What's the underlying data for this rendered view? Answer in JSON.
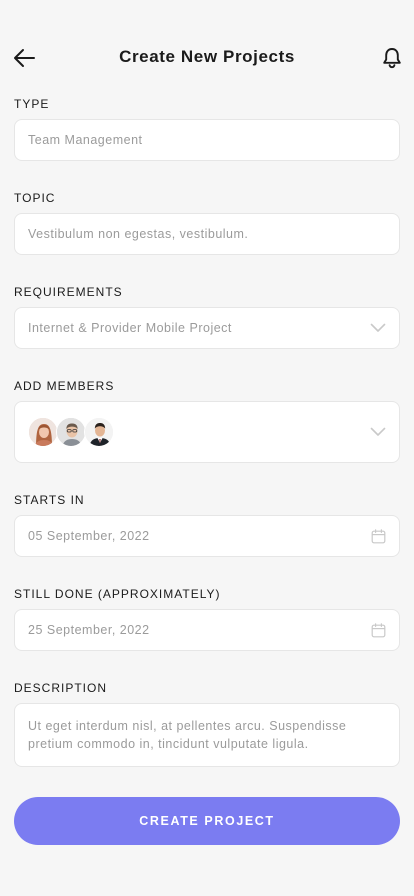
{
  "header": {
    "title": "Create New Projects",
    "back_icon": "arrow-left-icon",
    "notification_icon": "bell-icon"
  },
  "form": {
    "type": {
      "label": "TYPE",
      "value": "Team Management"
    },
    "topic": {
      "label": "TOPIC",
      "value": "Vestibulum non egestas, vestibulum."
    },
    "requirements": {
      "label": "REQUIREMENTS",
      "value": "Internet & Provider Mobile Project",
      "icon": "chevron-down-icon"
    },
    "members": {
      "label": "ADD MEMBERS",
      "avatars": [
        "avatar-woman",
        "avatar-man-glasses",
        "avatar-man-suit"
      ],
      "icon": "chevron-down-icon"
    },
    "starts_in": {
      "label": "STARTS IN",
      "value": "05 September, 2022",
      "icon": "calendar-icon"
    },
    "still_done": {
      "label": "STILL DONE (APPROXIMATELY)",
      "value": "25 September, 2022",
      "icon": "calendar-icon"
    },
    "description": {
      "label": "DESCRIPTION",
      "value": "Ut eget interdum nisl, at pellentes arcu. Suspendisse pretium commodo in, tincidunt vulputate ligula."
    }
  },
  "actions": {
    "create_label": "CREATE PROJECT"
  },
  "colors": {
    "accent": "#7b7cf1",
    "background": "#f6f6f6",
    "field_bg": "#ffffff",
    "field_border": "#e6e6e6",
    "placeholder": "#9b9b9b"
  }
}
